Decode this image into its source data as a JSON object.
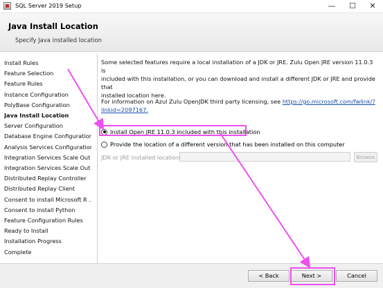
{
  "window": {
    "title": "SQL Server 2019 Setup",
    "minimize_glyph": "—",
    "maximize_glyph": "☐",
    "close_glyph": "✕"
  },
  "header": {
    "title": "Java Install Location",
    "subtitle": "Specify Java installed location"
  },
  "steps": [
    "Install Rules",
    "Feature Selection",
    "Feature Rules",
    "Instance Configuration",
    "PolyBase Configuration",
    "Java Install Location",
    "Server Configuration",
    "Database Engine Configuration",
    "Analysis Services Configuration",
    "Integration Services Scale Out ...",
    "Integration Services Scale Out ...",
    "Distributed Replay Controller",
    "Distributed Replay Client",
    "Consent to install Microsoft R ...",
    "Consent to install Python",
    "Feature Configuration Rules",
    "Ready to Install",
    "Installation Progress",
    "Complete"
  ],
  "active_step_index": 5,
  "content": {
    "intro_lines": [
      "Some selected features require a local installation of a JDK or JRE. Zulu Open JRE version 11.0.3 is",
      "included with this installation, or you can download and install a different JDK or JRE and provide that",
      "installed location here."
    ],
    "licensing_text": "For information on Azul Zulu OpenJDK third party licensing, see ",
    "licensing_link_part1": "https://go.microsoft.com/fwlink/?",
    "licensing_link_part2": "linkid=2097167.",
    "option_included": "Install Open JRE 11.0.3 included with this installation",
    "option_included_selected": true,
    "option_other": "Provide the location of a different version that has been installed on this computer",
    "location_label": "JDK or JRE installed location:",
    "location_value": "",
    "browse_label": "Browse"
  },
  "footer": {
    "back_label": "< Back",
    "next_label": "Next >",
    "cancel_label": "Cancel"
  },
  "colors": {
    "highlight": "#ee4fee",
    "link": "#1a4ba8"
  }
}
